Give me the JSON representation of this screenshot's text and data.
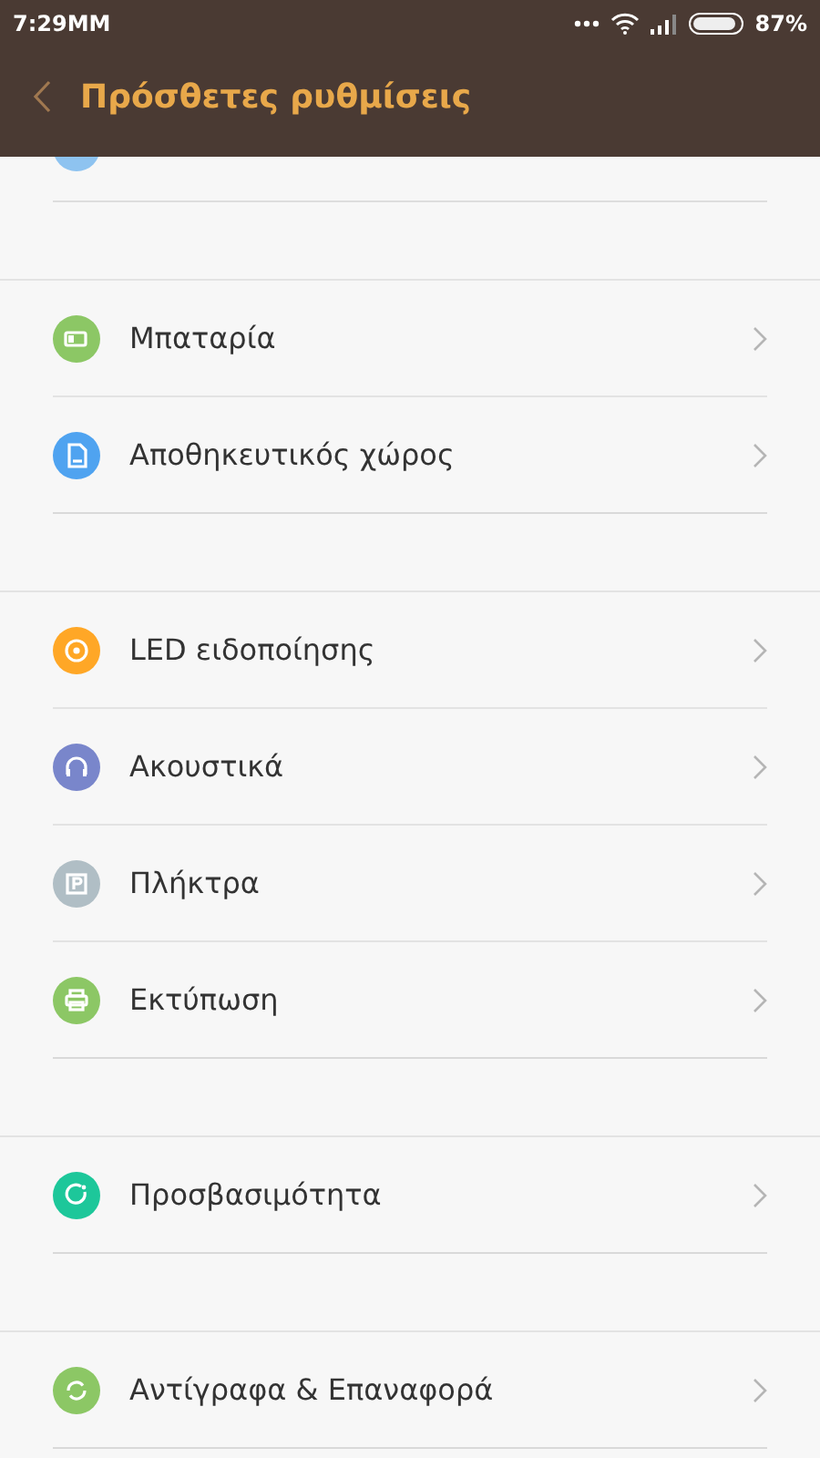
{
  "status_bar": {
    "time": "7:29MM",
    "battery": "87%"
  },
  "header": {
    "title": "Πρόσθετες ρυθμίσεις"
  },
  "groups": [
    {
      "items": [
        {
          "kind": "battery",
          "label": "Μπαταρία",
          "color": "#8cc765"
        },
        {
          "kind": "storage",
          "label": "Αποθηκευτικός χώρος",
          "color": "#4fa3f0"
        }
      ]
    },
    {
      "items": [
        {
          "kind": "led",
          "label": "LED ειδοποίησης",
          "color": "#ffa726"
        },
        {
          "kind": "headphones",
          "label": "Ακουστικά",
          "color": "#7986cb"
        },
        {
          "kind": "keys",
          "label": "Πλήκτρα",
          "color": "#b0bec5"
        },
        {
          "kind": "printer",
          "label": "Εκτύπωση",
          "color": "#8cc765"
        }
      ]
    },
    {
      "items": [
        {
          "kind": "accessibility",
          "label": "Προσβασιμότητα",
          "color": "#1dc79a"
        }
      ]
    },
    {
      "items": [
        {
          "kind": "backup",
          "label": "Αντίγραφα & Επαναφορά",
          "color": "#8cc765"
        }
      ]
    }
  ]
}
